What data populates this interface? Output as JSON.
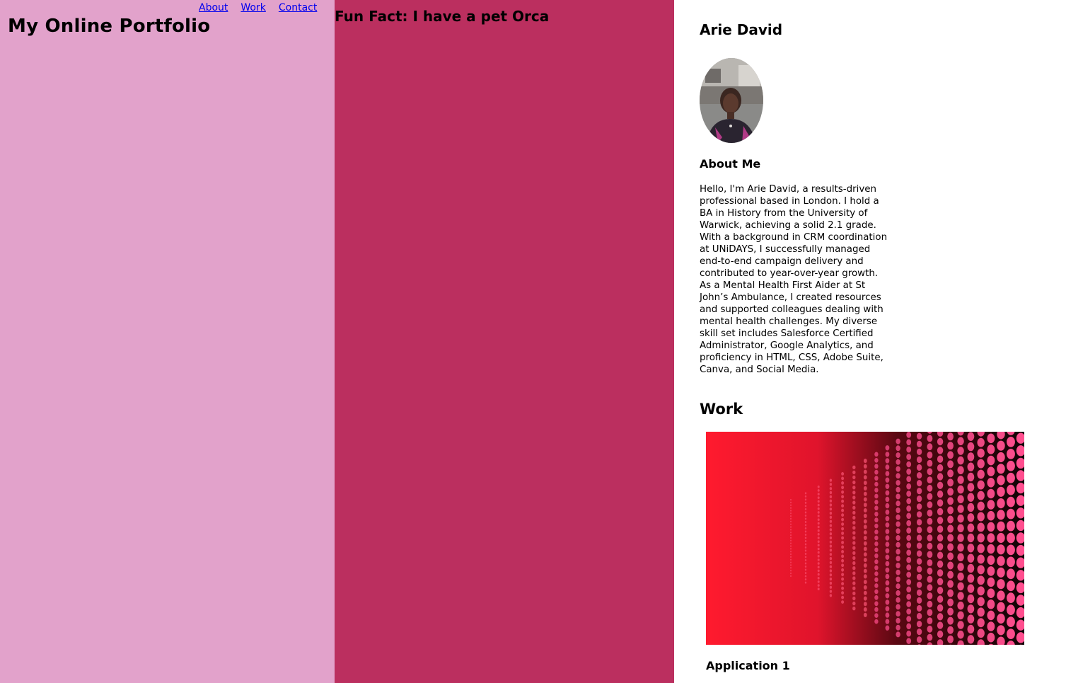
{
  "header": {
    "site_title": "My Online Portfolio",
    "nav": {
      "about": "About",
      "work": "Work",
      "contact": "Contact"
    }
  },
  "fun_fact": "Fun Fact: I have a pet Orca",
  "profile": {
    "name": "Arie David",
    "about_heading": "About Me",
    "about_text": "Hello, I'm Arie David, a results-driven professional based in London. I hold a BA in History from the University of Warwick, achieving a solid 2.1 grade. With a background in CRM coordination at UNiDAYS, I successfully managed end-to-end campaign delivery and contributed to year-over-year growth. As a Mental Health First Aider at St John’s Ambulance, I created resources and supported colleagues dealing with mental health challenges. My diverse skill set includes Salesforce Certified Administrator, Google Analytics, and proficiency in HTML, CSS, Adobe Suite, Canva, and Social Media."
  },
  "work": {
    "heading": "Work",
    "items": [
      {
        "title": "Application 1"
      }
    ]
  },
  "colors": {
    "left_panel": "#e2a2cb",
    "middle_panel": "#bb2f5f",
    "right_panel": "#ffffff",
    "link": "#0000ee"
  }
}
